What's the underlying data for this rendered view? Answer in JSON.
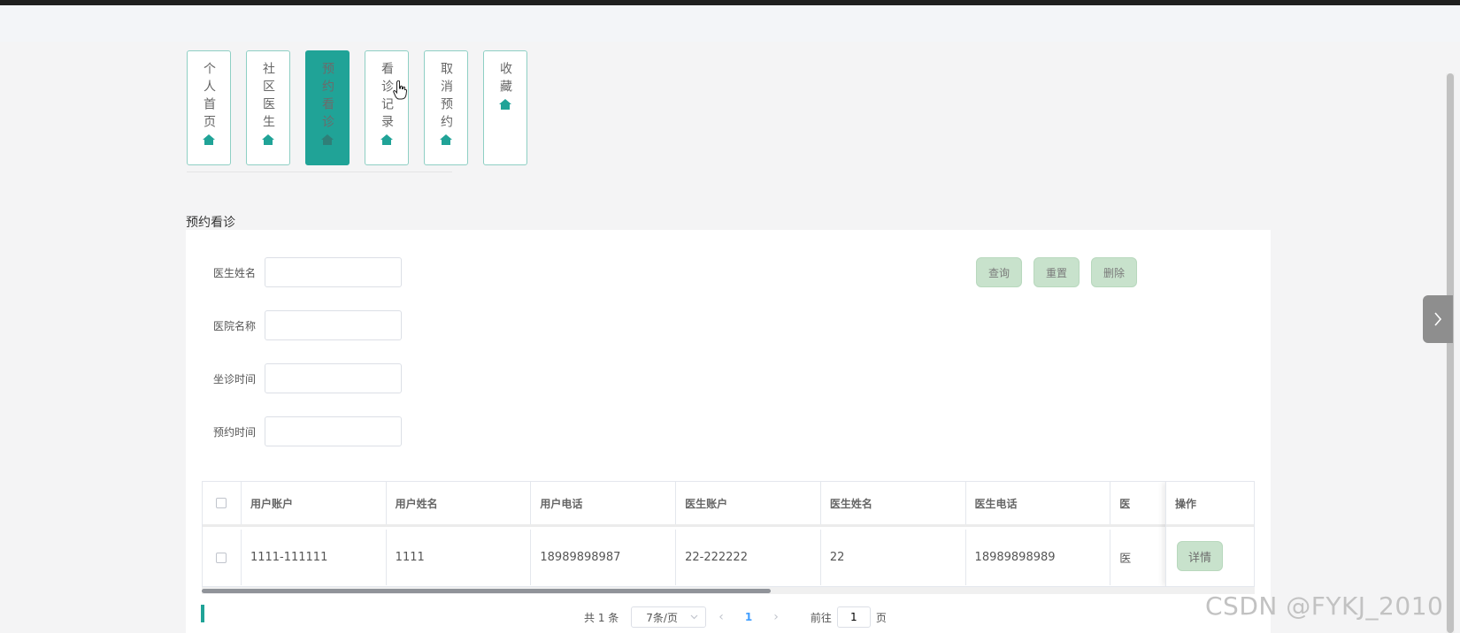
{
  "nav": {
    "tabs": [
      {
        "label": "个人首页",
        "active": false
      },
      {
        "label": "社区医生",
        "active": false
      },
      {
        "label": "预约看诊",
        "active": true
      },
      {
        "label": "看诊记录",
        "active": false
      },
      {
        "label": "取消预约",
        "active": false
      },
      {
        "label": "收藏",
        "active": false
      }
    ]
  },
  "section_title": "预约看诊",
  "search": {
    "fields": [
      {
        "label": "医生姓名",
        "value": ""
      },
      {
        "label": "医院名称",
        "value": ""
      },
      {
        "label": "坐诊时间",
        "value": ""
      },
      {
        "label": "预约时间",
        "value": ""
      }
    ],
    "buttons": {
      "query": "查询",
      "reset": "重置",
      "delete": "删除"
    }
  },
  "table": {
    "columns": [
      "用户账户",
      "用户姓名",
      "用户电话",
      "医生账户",
      "医生姓名",
      "医生电话",
      "医"
    ],
    "action_header": "操作",
    "rows": [
      {
        "cells": [
          "1111-111111",
          "1111",
          "18989898987",
          "22-222222",
          "22",
          "18989898989",
          "医"
        ],
        "action": "详情"
      }
    ]
  },
  "pagination": {
    "total": "共 1 条",
    "page_size": "7条/页",
    "current_page": "1",
    "goto_prefix": "前往",
    "goto_value": "1",
    "goto_suffix": "页"
  },
  "watermark": "CSDN @FYKJ_2010",
  "colors": {
    "accent": "#20a397",
    "button_bg": "#c8e2cc",
    "nav_border": "#8ecfc4"
  }
}
